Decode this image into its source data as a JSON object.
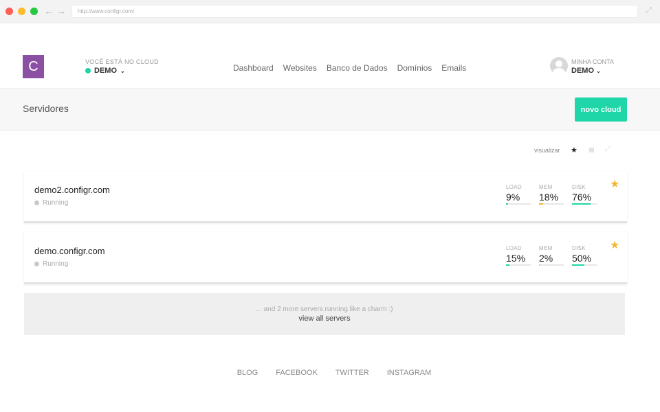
{
  "browser": {
    "url": "http://www.configr.com/"
  },
  "header": {
    "logo_letter": "C",
    "cloud_label": "VOCÊ ESTÁ NO CLOUD",
    "cloud_name": "DEMO",
    "nav": [
      "Dashboard",
      "Websites",
      "Banco de Dados",
      "Domínios",
      "Emails"
    ],
    "account_label": "MINHA CONTA",
    "account_name": "DEMO"
  },
  "subheader": {
    "title": "Servidores",
    "new_button": "novo cloud"
  },
  "view": {
    "label": "visualizar"
  },
  "servers": [
    {
      "host": "demo2.configr.com",
      "status": "Running",
      "load_label": "LOAD",
      "load": "9%",
      "load_pct": 9,
      "mem_label": "MEM",
      "mem": "18%",
      "mem_pct": 18,
      "disk_label": "DISK",
      "disk": "76%",
      "disk_pct": 76
    },
    {
      "host": "demo.configr.com",
      "status": "Running",
      "load_label": "LOAD",
      "load": "15%",
      "load_pct": 15,
      "mem_label": "MEM",
      "mem": "2%",
      "mem_pct": 2,
      "disk_label": "DISK",
      "disk": "50%",
      "disk_pct": 50
    }
  ],
  "more": {
    "message": "... and 2 more servers running like a charm :)",
    "link": "view all servers"
  },
  "footer": [
    "BLOG",
    "FACEBOOK",
    "TWITTER",
    "INSTAGRAM"
  ],
  "colors": {
    "accent": "#1fd6a8",
    "logo": "#8b4fa3",
    "star": "#f2b632",
    "mem_bar": "#f2b632",
    "load_bar": "#1fd6a8",
    "disk_bar": "#1fd6a8"
  },
  "icons": {
    "favorite": "star-icon",
    "view_list": "star-icon",
    "view_grid": "grid-icon",
    "view_expand": "expand-icon"
  }
}
